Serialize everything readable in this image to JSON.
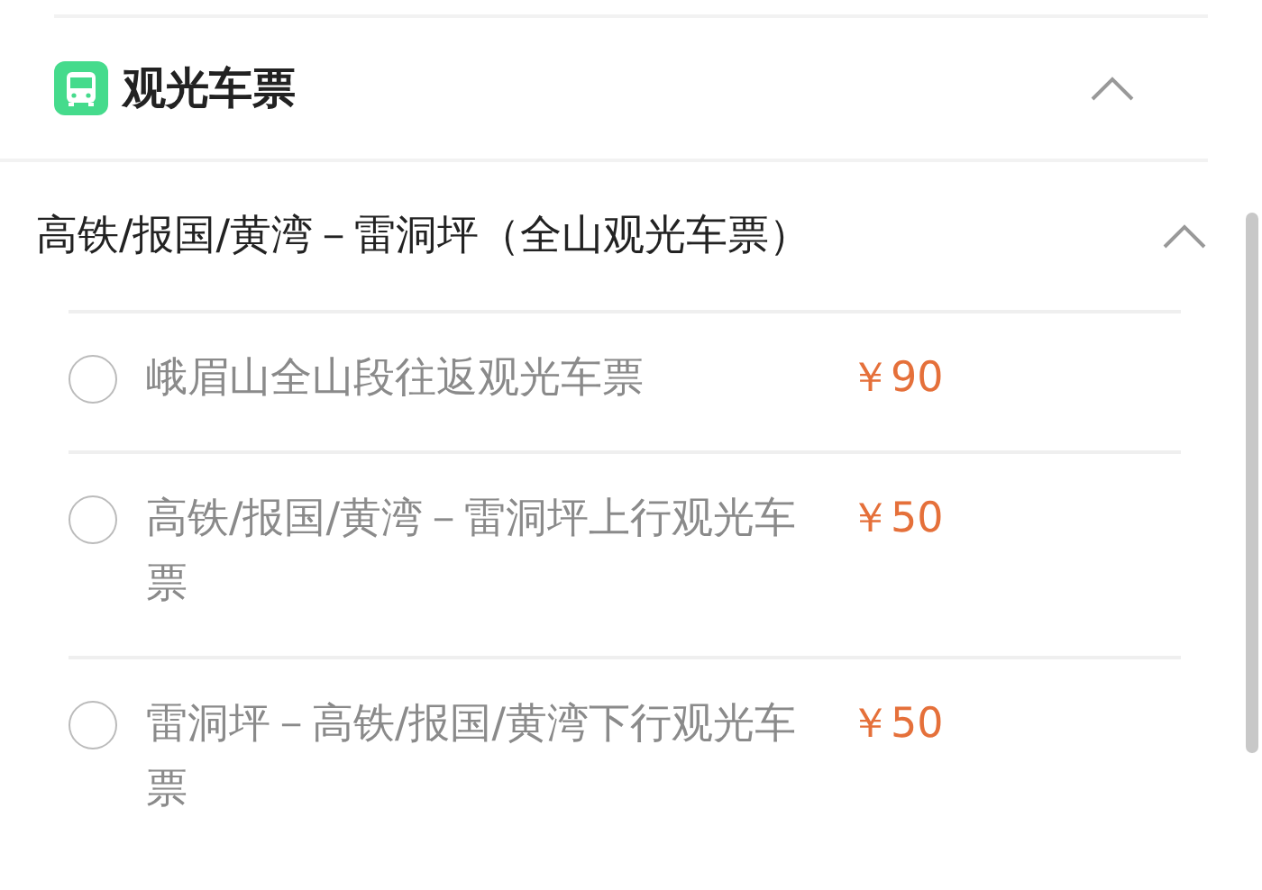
{
  "section": {
    "title": "观光车票",
    "expanded": true
  },
  "group": {
    "title": "高铁/报国/黄湾－雷洞坪（全山观光车票）",
    "expanded": true
  },
  "tickets": [
    {
      "name": "峨眉山全山段往返观光车票",
      "price": "￥90",
      "selected": false
    },
    {
      "name": "高铁/报国/黄湾－雷洞坪上行观光车票",
      "price": "￥50",
      "selected": false
    },
    {
      "name": "雷洞坪－高铁/报国/黄湾下行观光车票",
      "price": "￥50",
      "selected": false
    }
  ]
}
